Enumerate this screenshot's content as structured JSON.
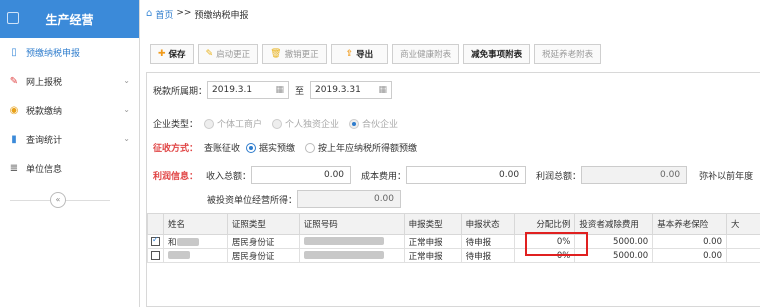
{
  "sidebar": {
    "title": "生产经营",
    "items": [
      {
        "label": "预缴纳税申报",
        "icon": "document-icon",
        "active": true
      },
      {
        "label": "网上报税",
        "icon": "pen-icon",
        "active": false
      },
      {
        "label": "税款缴纳",
        "icon": "coin-icon",
        "active": false
      },
      {
        "label": "查询统计",
        "icon": "chart-icon",
        "active": false
      },
      {
        "label": "单位信息",
        "icon": "list-icon",
        "active": false
      }
    ],
    "collapse_label": "«"
  },
  "breadcrumb": {
    "home": "首页",
    "sep": ">>",
    "current": "预缴纳税申报"
  },
  "toolbar": {
    "save": "保存",
    "enable_correction": "启动更正",
    "cancel_correction": "撤销更正",
    "export": "导出",
    "health_insurance": "商业健康附表",
    "relief_items": "减免事项附表",
    "investor_attachment": "税延养老附表"
  },
  "form": {
    "period_label": "税款所属期：",
    "period_start": "2019.3.1",
    "period_to": "至",
    "period_end": "2019.3.31",
    "enterprise_type_label": "企业类型：",
    "enterprise_types": [
      "个体工商户",
      "个人独资企业",
      "合伙企业"
    ],
    "collection_label": "征收方式：",
    "collection_prefix": "查账征收",
    "collection_opt1": "据实预缴",
    "collection_opt2": "按上年应纳税所得额预缴",
    "profit_label": "利润信息：",
    "income_label": "收入总额：",
    "income_value": "0.00",
    "cost_label": "成本费用：",
    "cost_value": "0.00",
    "profit_total_label": "利润总额：",
    "profit_total_value": "0.00",
    "make_up_label": "弥补以前年度",
    "investor_income_label": "被投资单位经营所得：",
    "investor_income_value": "0.00"
  },
  "table": {
    "headers": [
      "姓名",
      "证照类型",
      "证照号码",
      "申报类型",
      "申报状态",
      "分配比例",
      "投资者减除费用",
      "基本养老保险",
      "大"
    ],
    "rows": [
      {
        "checked": true,
        "name_prefix": "和",
        "id_type": "居民身份证",
        "decl_type": "正常申报",
        "status": "待申报",
        "ratio": "0%",
        "deduction": "5000.00",
        "pension": "0.00"
      },
      {
        "checked": false,
        "name_prefix": "",
        "id_type": "居民身份证",
        "decl_type": "正常申报",
        "status": "待申报",
        "ratio": "0%",
        "deduction": "5000.00",
        "pension": "0.00"
      }
    ]
  },
  "colors": {
    "accent": "#3b8ad9",
    "red": "#e04545",
    "highlight": "#e02020"
  }
}
